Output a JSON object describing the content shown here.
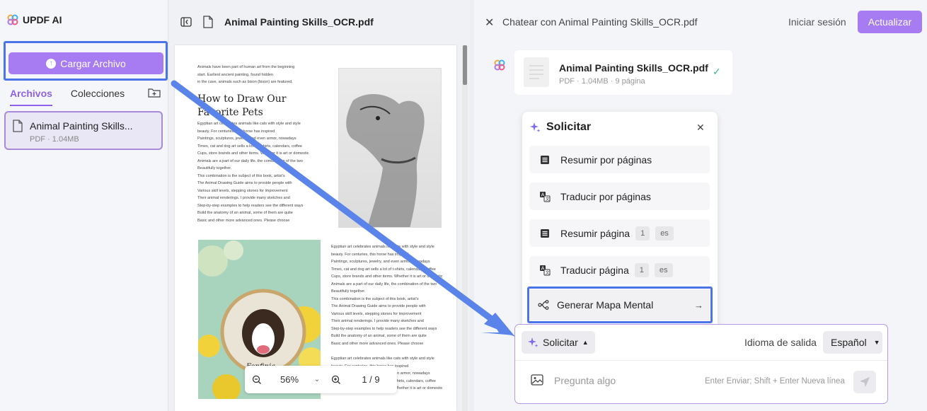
{
  "sidebar": {
    "brand": "UPDF AI",
    "upload_label": "Cargar Archivo",
    "tabs": [
      "Archivos",
      "Colecciones"
    ],
    "file": {
      "name": "Animal Painting Skills...",
      "meta": "PDF · 1.04MB"
    }
  },
  "viewer": {
    "title": "Animal Painting Skills_OCR.pdf",
    "zoom": "56%",
    "page_indicator": "1 / 9",
    "page": {
      "intro": [
        "Animals have been part of human art from the beginning",
        "start. Earliest ancient painting, found hidden",
        "in the cave, animals such as bison (bison) are featured."
      ],
      "heading": [
        "How to Draw Our",
        "Favorite Pets"
      ],
      "body": [
        "Egyptian art celebrates animals like cats with style and style",
        "beauty. For centuries, this horse has inspired",
        "Paintings, sculptures, jewelry, and even armor, nowadays",
        "Times, cat and dog art sells a lot of t-shirts, calendars, coffee",
        "Cups, store brands and other items. Whether it is art or domestic",
        "Animals are a part of our daily life, the combination of the two",
        "Beautifully together.",
        "This combination is the subject of this book, artist's",
        "The Animal Drawing Guide aims to provide people with",
        "Various skill levels, stepping stones for improvement",
        "Their animal renderings. I provide many sketches and",
        "Step-by-step examples to help readers see the different ways",
        "Build the anatomy of an animal, some of them are quite",
        "Basic and other more advanced ones. Please choose"
      ],
      "body2": [
        "Egyptian art celebrates animals like cats with style and style",
        "beauty. For centuries, this horse has inspired",
        "Paintings, sculptures, jewelry, and even armor, nowadays",
        "Times, cat and dog art sells a lot of t-shirts, calendars, coffee",
        "Cups, store brands and other items. Whether it is art or domestic",
        "Animals are a part of our daily life, the combination of the two",
        "Beautifully together.",
        "This combination is the subject of this book, artist's",
        "The Animal Drawing Guide aims to provide people with",
        "Various skill levels, stepping stones for improvement",
        "Their animal renderings. I provide many sketches and",
        "Step-by-step examples to help readers see the different ways",
        "Build the anatomy of an animal, some of them are quite",
        "Basic and other more advanced ones. Please choose"
      ],
      "body3": [
        "Egyptian art celebrates animals like cats with style and style",
        "beauty. For centuries, this horse has inspired",
        "Paintings, sculptures, jewelry, and even armor, nowadays",
        "Times, cat and dog art sells a lot of t-shirts, calendars, coffee",
        "Cups, store brands and other items. Whether it is art or domestic"
      ],
      "photo_caption": "Fonfinia"
    }
  },
  "chat": {
    "title": "Chatear con Animal Painting Skills_OCR.pdf",
    "login": "Iniciar sesión",
    "upgrade": "Actualizar",
    "file_card": {
      "name": "Animal Painting Skills_OCR.pdf",
      "meta": "PDF · 1.04MB · 9 página"
    },
    "prompt": {
      "title": "Solicitar",
      "options": [
        {
          "label": "Resumir por páginas",
          "icon": "list-icon"
        },
        {
          "label": "Traducir por páginas",
          "icon": "translate-icon"
        },
        {
          "label": "Resumir página",
          "icon": "list-icon",
          "page": "1",
          "lang": "es"
        },
        {
          "label": "Traducir página",
          "icon": "translate-icon",
          "page": "1",
          "lang": "es"
        }
      ],
      "mind_map": "Generar Mapa Mental"
    },
    "input": {
      "solicitar": "Solicitar",
      "lang_label": "Idioma de salida",
      "lang_value": "Español",
      "placeholder": "Pregunta algo",
      "hint": "Enter Enviar; Shift + Enter Nueva línea"
    }
  },
  "colors": {
    "accent": "#a77bf2",
    "highlight_border": "#4a74e8",
    "check": "#3ab58a"
  }
}
